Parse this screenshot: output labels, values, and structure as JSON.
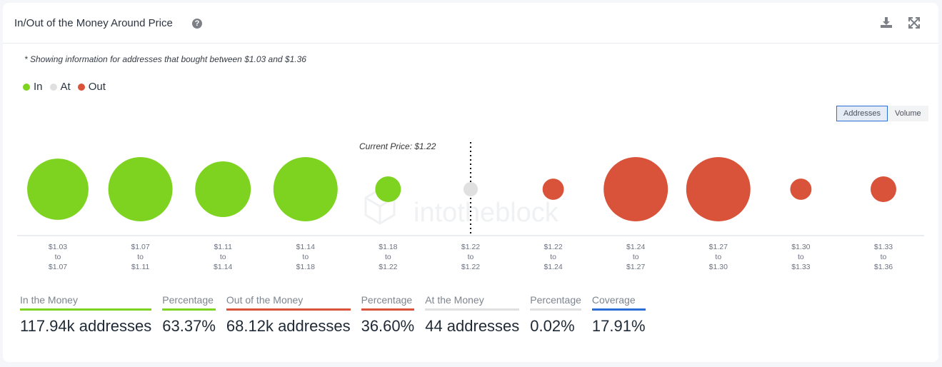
{
  "header": {
    "title": "In/Out of the Money Around Price",
    "help_glyph": "?",
    "icons": [
      "download-icon",
      "expand-icon"
    ]
  },
  "note": "* Showing information for addresses that bought between $1.03 and $1.36",
  "legend": [
    {
      "label": "In",
      "color": "#7ed321"
    },
    {
      "label": "At",
      "color": "#e0e0e0"
    },
    {
      "label": "Out",
      "color": "#d9533a"
    }
  ],
  "toggle": {
    "options": [
      "Addresses",
      "Volume"
    ],
    "selected": "Addresses"
  },
  "chart_data": {
    "type": "bubble",
    "title": "In/Out of the Money Around Price",
    "current_price_label": "Current Price: $1.22",
    "current_price_index": 5,
    "watermark": "intotheblock",
    "colors": {
      "in": "#7ed321",
      "at": "#e0e0e0",
      "out": "#d9533a"
    },
    "categories": [
      {
        "from": "$1.03",
        "to": "$1.07",
        "status": "in",
        "relative_size": 0.91
      },
      {
        "from": "$1.07",
        "to": "$1.11",
        "status": "in",
        "relative_size": 1.0
      },
      {
        "from": "$1.11",
        "to": "$1.14",
        "status": "in",
        "relative_size": 0.75
      },
      {
        "from": "$1.14",
        "to": "$1.18",
        "status": "in",
        "relative_size": 1.0
      },
      {
        "from": "$1.18",
        "to": "$1.22",
        "status": "in",
        "relative_size": 0.16
      },
      {
        "from": "$1.22",
        "to": "$1.22",
        "status": "at",
        "relative_size": 0.05
      },
      {
        "from": "$1.22",
        "to": "$1.24",
        "status": "out",
        "relative_size": 0.11
      },
      {
        "from": "$1.24",
        "to": "$1.27",
        "status": "out",
        "relative_size": 1.0
      },
      {
        "from": "$1.27",
        "to": "$1.30",
        "status": "out",
        "relative_size": 1.0
      },
      {
        "from": "$1.30",
        "to": "$1.33",
        "status": "out",
        "relative_size": 0.11
      },
      {
        "from": "$1.33",
        "to": "$1.36",
        "status": "out",
        "relative_size": 0.16
      }
    ],
    "tick_joiner": "to"
  },
  "stats": [
    {
      "label": "In the Money",
      "value": "117.94k addresses",
      "color": "#7ed321"
    },
    {
      "label": "Percentage",
      "value": "63.37%",
      "color": "#7ed321"
    },
    {
      "label": "Out of the Money",
      "value": "68.12k addresses",
      "color": "#d9533a"
    },
    {
      "label": "Percentage",
      "value": "36.60%",
      "color": "#d9533a"
    },
    {
      "label": "At the Money",
      "value": "44 addresses",
      "color": "#e0e0e0"
    },
    {
      "label": "Percentage",
      "value": "0.02%",
      "color": "#e0e0e0"
    },
    {
      "label": "Coverage",
      "value": "17.91%",
      "color": "#2b6fd6"
    }
  ]
}
